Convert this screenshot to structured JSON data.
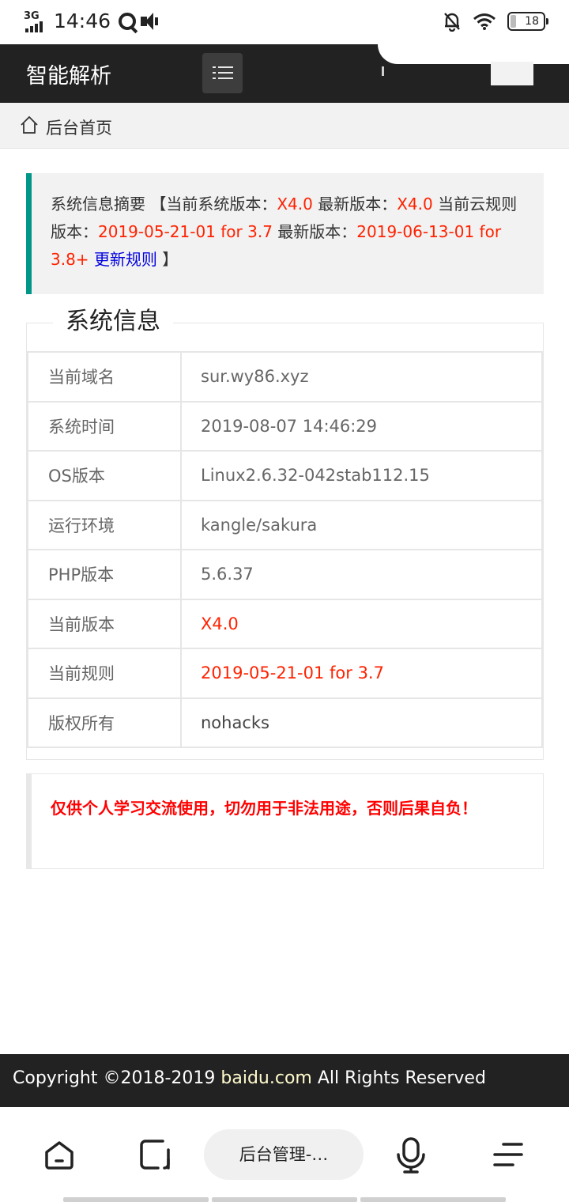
{
  "status_bar": {
    "network": "3G",
    "time": "14:46",
    "battery": "18",
    "icons": [
      "signal-icon",
      "qq-icon",
      "speaker-icon",
      "mute-bell-icon",
      "wifi-icon",
      "battery-icon"
    ]
  },
  "header": {
    "brand": "智能解析",
    "menu_icon": "list-menu-icon"
  },
  "breadcrumb": {
    "label": "后台首页",
    "icon": "home-icon"
  },
  "summary": {
    "title": "系统信息摘要",
    "open_bracket": "【",
    "current_version_label": "当前系统版本：",
    "current_version": "X4.0",
    "latest_version_label": "最新版本：",
    "latest_version": "X4.0",
    "current_rule_label": "当前云规则版本：",
    "current_rule": "2019-05-21-01 for 3.7",
    "latest_rule_label": "最新版本：",
    "latest_rule": "2019-06-13-01 for 3.8+",
    "update_link": "更新规则",
    "close_bracket": "】"
  },
  "system_info": {
    "legend": "系统信息",
    "rows": [
      {
        "key": "当前域名",
        "value": "sur.wy86.xyz"
      },
      {
        "key": "系统时间",
        "value": "2019-08-07 14:46:29"
      },
      {
        "key": "OS版本",
        "value": "Linux2.6.32-042stab112.15"
      },
      {
        "key": "运行环境",
        "value": "kangle/sakura"
      },
      {
        "key": "PHP版本",
        "value": "5.6.37"
      },
      {
        "key": "当前版本",
        "value": "X4.0"
      },
      {
        "key": "当前规则",
        "value": "2019-05-21-01 for 3.7"
      },
      {
        "key": "版权所有",
        "value": "nohacks"
      }
    ]
  },
  "warning": {
    "text": "仅供个人学习交流使用，切勿用于非法用途，否则后果自负！"
  },
  "footer": {
    "prefix": "Copyright ©2018-2019 ",
    "domain": "baidu.com",
    "suffix": " All Rights Reserved"
  },
  "browser_bar": {
    "tab_title": "后台管理-…",
    "icons": [
      "home-icon",
      "tabs-icon",
      "microphone-icon",
      "menu-icon"
    ]
  },
  "colors": {
    "header_bg": "#222222",
    "accent": "#009688",
    "highlight_red": "#ff2200",
    "link_blue": "#0000dd"
  }
}
